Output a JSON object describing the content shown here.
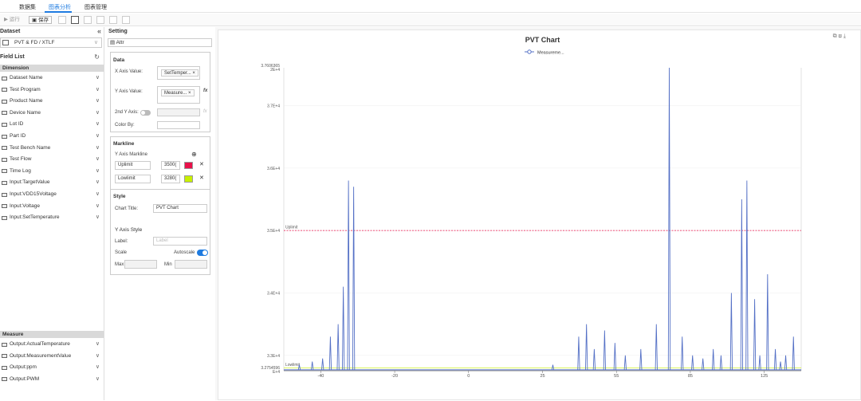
{
  "topnav": {
    "tabs": [
      "数据集",
      "图表分析",
      "图表管理"
    ]
  },
  "toolbar": {
    "run_label": "▶ 运行",
    "save_label": "保存"
  },
  "left": {
    "title": "Dataset",
    "dataset": "PVT & FD / XTLF",
    "field_list_title": "Field List",
    "dimension_title": "Dimension",
    "dimensions": [
      "Dataset Name",
      "Test Program",
      "Product Name",
      "Device Name",
      "Lot ID",
      "Part ID",
      "Test Bench Name",
      "Test Flow",
      "Time Log",
      "Input:TargetValue",
      "Input:VDD15Voltage",
      "Input:Voltage",
      "Input:SetTemperature"
    ],
    "measure_title": "Measure",
    "measures": [
      "Output:ActualTemperature",
      "Output:MeasurementValue",
      "Output:ppm",
      "Output:PWM"
    ]
  },
  "setting": {
    "title": "Setting",
    "attr_label": "Attr",
    "data_title": "Data",
    "x_axis_label": "X Axis Value:",
    "x_axis_tag": "SetTemper...",
    "y_axis_label": "Y Axis Value:",
    "y_axis_tag": "Measure...",
    "fx_label": "fx",
    "second_y_label": "2nd Y Axis:",
    "color_by_label": "Color By:",
    "markline_title": "Markline",
    "y_axis_markline_label": "Y Axis Markline",
    "markline1_name": "Uplimit",
    "markline1_value": "3500(",
    "markline1_color": "#e8114a",
    "markline2_name": "Lowlimit",
    "markline2_value": "3280(",
    "markline2_color": "#c8f000",
    "style_title": "Style",
    "chart_title_label": "Chart Title:",
    "chart_title_value": "PVT Chart",
    "y_axis_style_title": "Y Axis Style",
    "label_label": "Label:",
    "label_placeholder": "Label",
    "scale_label": "Scale",
    "autoscale_label": "Autoscale",
    "max_label": "Max",
    "min_label": "Min"
  },
  "chart_data": {
    "type": "line",
    "title": "PVT Chart",
    "legend": [
      "Measureme..."
    ],
    "legend_position": "top-center",
    "color": "#5470c6",
    "y_top_label": "3.7606365\n2E+4",
    "y_bottom_label": "3.2754596\nE+4",
    "y_ticks": [
      "3.7E+4",
      "3.6E+4",
      "3.5E+4",
      "3.4E+4",
      "3.3E+4"
    ],
    "x_ticks": [
      "-40",
      "-20",
      "0",
      "25",
      "55",
      "85",
      "125"
    ],
    "ylim": [
      32754.596,
      37606.3652
    ],
    "marklines": [
      {
        "name": "Uplimit",
        "value": 35000,
        "color": "#e8114a"
      },
      {
        "name": "Lowlimit",
        "value": 32800,
        "color": "#c8f000"
      }
    ],
    "spikes": [
      {
        "x": 0.03,
        "v": 32850
      },
      {
        "x": 0.055,
        "v": 32900
      },
      {
        "x": 0.075,
        "v": 32950
      },
      {
        "x": 0.09,
        "v": 33300
      },
      {
        "x": 0.105,
        "v": 33500
      },
      {
        "x": 0.115,
        "v": 34100
      },
      {
        "x": 0.125,
        "v": 35800
      },
      {
        "x": 0.135,
        "v": 35700
      },
      {
        "x": 0.52,
        "v": 32850
      },
      {
        "x": 0.57,
        "v": 33300
      },
      {
        "x": 0.585,
        "v": 33500
      },
      {
        "x": 0.6,
        "v": 33100
      },
      {
        "x": 0.62,
        "v": 33400
      },
      {
        "x": 0.64,
        "v": 33200
      },
      {
        "x": 0.66,
        "v": 33000
      },
      {
        "x": 0.69,
        "v": 33100
      },
      {
        "x": 0.72,
        "v": 33500
      },
      {
        "x": 0.745,
        "v": 37606
      },
      {
        "x": 0.77,
        "v": 33300
      },
      {
        "x": 0.79,
        "v": 33000
      },
      {
        "x": 0.81,
        "v": 32950
      },
      {
        "x": 0.83,
        "v": 33100
      },
      {
        "x": 0.845,
        "v": 33000
      },
      {
        "x": 0.865,
        "v": 34000
      },
      {
        "x": 0.885,
        "v": 35500
      },
      {
        "x": 0.895,
        "v": 35800
      },
      {
        "x": 0.91,
        "v": 33900
      },
      {
        "x": 0.92,
        "v": 33000
      },
      {
        "x": 0.935,
        "v": 34300
      },
      {
        "x": 0.95,
        "v": 33100
      },
      {
        "x": 0.96,
        "v": 32900
      },
      {
        "x": 0.97,
        "v": 33000
      },
      {
        "x": 0.985,
        "v": 33300
      }
    ]
  }
}
